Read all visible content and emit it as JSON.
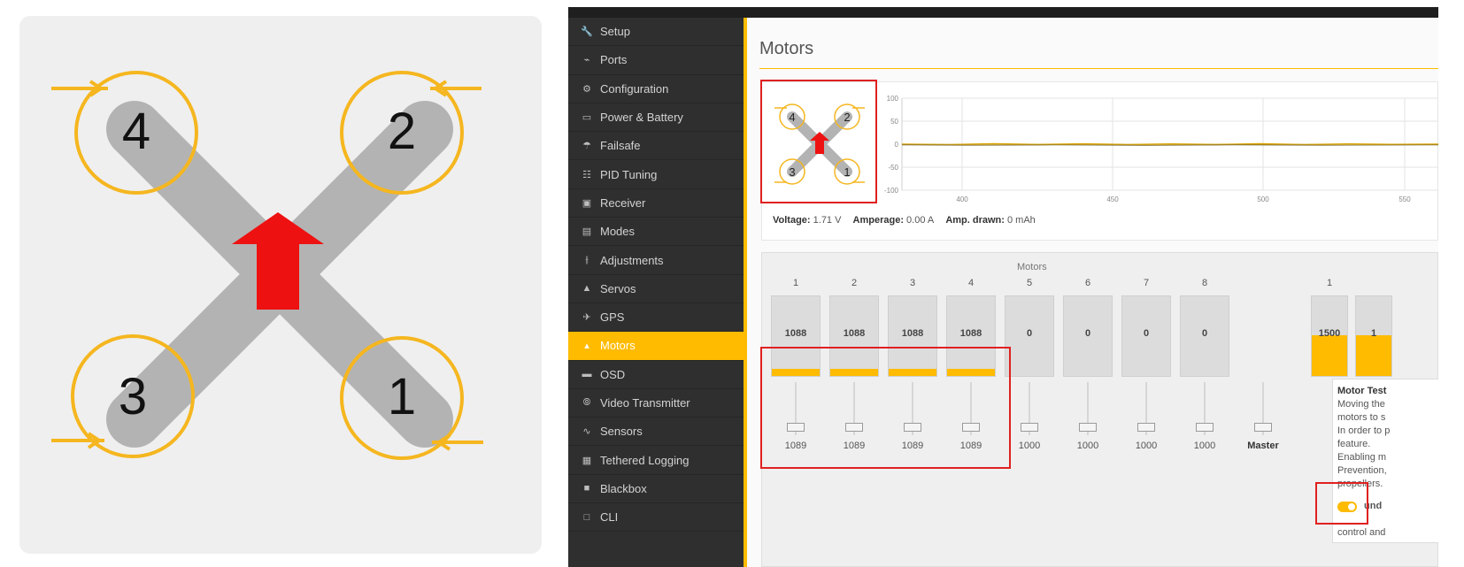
{
  "diagram": {
    "motors": [
      "1",
      "2",
      "3",
      "4"
    ],
    "colors": {
      "arm": "#b3b3b3",
      "prop_ring": "#f5b61f",
      "arrow": "#ee1111",
      "background": "#efefef"
    }
  },
  "sidebar": {
    "items": [
      {
        "label": "Setup",
        "icon": "wrench-icon"
      },
      {
        "label": "Ports",
        "icon": "plug-icon"
      },
      {
        "label": "Configuration",
        "icon": "gear-icon"
      },
      {
        "label": "Power & Battery",
        "icon": "battery-icon"
      },
      {
        "label": "Failsafe",
        "icon": "parachute-icon"
      },
      {
        "label": "PID Tuning",
        "icon": "sitemap-icon"
      },
      {
        "label": "Receiver",
        "icon": "receiver-icon"
      },
      {
        "label": "Modes",
        "icon": "modes-icon"
      },
      {
        "label": "Adjustments",
        "icon": "sliders-icon"
      },
      {
        "label": "Servos",
        "icon": "servo-icon"
      },
      {
        "label": "GPS",
        "icon": "satellite-icon"
      },
      {
        "label": "Motors",
        "icon": "flame-icon"
      },
      {
        "label": "OSD",
        "icon": "osd-icon"
      },
      {
        "label": "Video Transmitter",
        "icon": "antenna-icon"
      },
      {
        "label": "Sensors",
        "icon": "pulse-icon"
      },
      {
        "label": "Tethered Logging",
        "icon": "logging-icon"
      },
      {
        "label": "Blackbox",
        "icon": "blackbox-icon"
      },
      {
        "label": "CLI",
        "icon": "terminal-icon"
      }
    ],
    "active": "Motors"
  },
  "main": {
    "title": "Motors",
    "graph": {
      "y_ticks": [
        "100",
        "50",
        "0",
        "-50",
        "-100"
      ],
      "x_ticks": [
        "400",
        "450",
        "500",
        "550"
      ]
    },
    "readout": {
      "voltage_label": "Voltage:",
      "voltage_value": "1.71 V",
      "amperage_label": "Amperage:",
      "amperage_value": "0.00 A",
      "drawn_label": "Amp. drawn:",
      "drawn_value": "0 mAh"
    },
    "motors_panel": {
      "heading": "Motors",
      "motors": [
        {
          "num": "1",
          "value": "1088",
          "slider": "1089",
          "fill": 0.09
        },
        {
          "num": "2",
          "value": "1088",
          "slider": "1089",
          "fill": 0.09
        },
        {
          "num": "3",
          "value": "1088",
          "slider": "1089",
          "fill": 0.09
        },
        {
          "num": "4",
          "value": "1088",
          "slider": "1089",
          "fill": 0.09
        },
        {
          "num": "5",
          "value": "0",
          "slider": "1000",
          "fill": 0
        },
        {
          "num": "6",
          "value": "0",
          "slider": "1000",
          "fill": 0
        },
        {
          "num": "7",
          "value": "0",
          "slider": "1000",
          "fill": 0
        },
        {
          "num": "8",
          "value": "0",
          "slider": "1000",
          "fill": 0
        }
      ],
      "master_label": "Master",
      "servos": [
        {
          "num": "1",
          "value": "1500",
          "fill": 0.5
        },
        {
          "num": "",
          "value": "1",
          "fill": 0.5
        }
      ]
    },
    "motor_test": {
      "heading": "Motor Test",
      "lines": [
        "Moving the",
        "motors to s",
        "In order to p",
        "feature.",
        "Enabling m",
        "Prevention,",
        "propellers."
      ],
      "toggle_text": "und",
      "trailing_text": "control and"
    }
  }
}
